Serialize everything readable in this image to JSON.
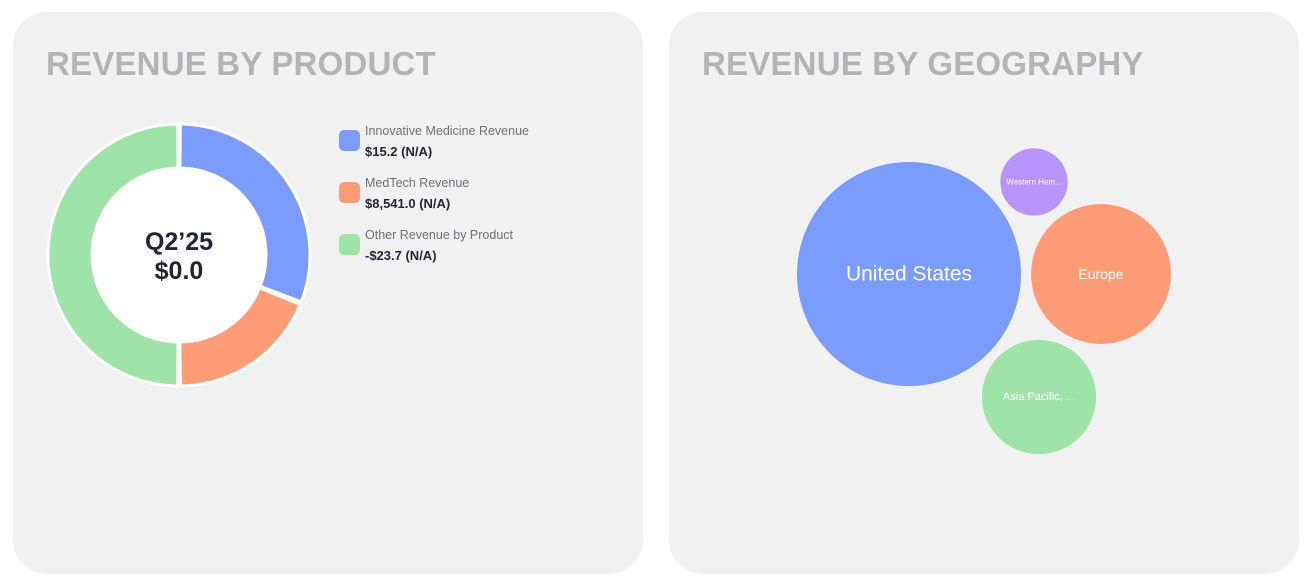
{
  "colors": {
    "blue": "#7b9cfd",
    "orange": "#ff9c78",
    "green": "#9ee3a7",
    "purple": "#b793fc",
    "card_bg": "#f1f1f1",
    "title": "#b3b4b8"
  },
  "product_card": {
    "title": "REVENUE BY PRODUCT",
    "center_period": "Q2’25",
    "center_value": "$0.0",
    "legend": [
      {
        "label": "Innovative Medicine Revenue",
        "value": "$15.2 (N/A)",
        "color": "#7b9cfd"
      },
      {
        "label": "MedTech Revenue",
        "value": "$8,541.0 (N/A)",
        "color": "#ff9c78"
      },
      {
        "label": "Other Revenue by Product",
        "value": "-$23.7 (N/A)",
        "color": "#9ee3a7"
      }
    ]
  },
  "geo_card": {
    "title": "REVENUE BY GEOGRAPHY"
  },
  "chart_data": [
    {
      "type": "pie",
      "variant": "donut",
      "title": "REVENUE BY PRODUCT",
      "center_label": "Q2’25",
      "center_value": "$0.0",
      "series": [
        {
          "name": "Innovative Medicine Revenue",
          "display": "$15.2 (N/A)",
          "share": 0.31,
          "color": "#7b9cfd"
        },
        {
          "name": "MedTech Revenue",
          "display": "$8,541.0 (N/A)",
          "share": 0.19,
          "color": "#ff9c78"
        },
        {
          "name": "Other Revenue by Product",
          "display": "-$23.7 (N/A)",
          "share": 0.5,
          "color": "#9ee3a7"
        }
      ],
      "legend": "right"
    },
    {
      "type": "bubble",
      "title": "REVENUE BY GEOGRAPHY",
      "series": [
        {
          "name": "United States",
          "label": "United States",
          "relative_size": 1.0,
          "color": "#7b9cfd"
        },
        {
          "name": "Europe",
          "label": "Europe",
          "relative_size": 0.39,
          "color": "#ff9c78"
        },
        {
          "name": "Asia Pacific, Africa",
          "label": "Asia Pacific, ...",
          "relative_size": 0.26,
          "color": "#9ee3a7"
        },
        {
          "name": "Western Hemisphere",
          "label": "Western Hem...",
          "relative_size": 0.09,
          "color": "#b793fc"
        }
      ]
    }
  ]
}
